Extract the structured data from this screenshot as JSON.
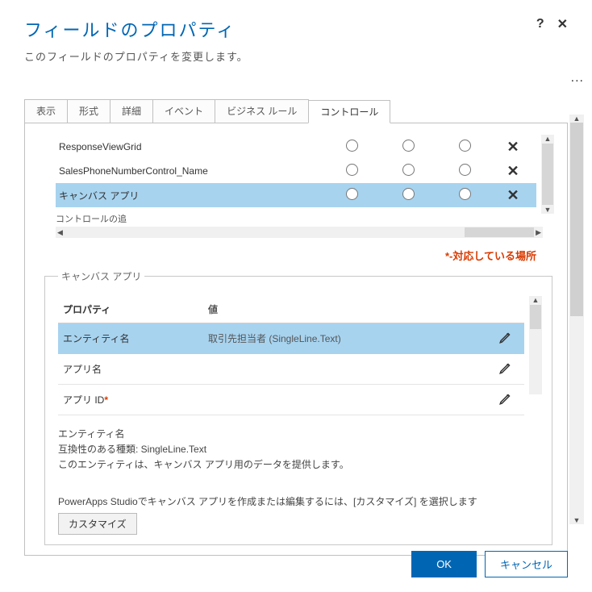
{
  "header": {
    "title": "フィールドのプロパティ",
    "subtitle": "このフィールドのプロパティを変更します。",
    "help_icon": "?",
    "close_icon": "✕",
    "overflow": "..."
  },
  "tabs": [
    {
      "label": "表示"
    },
    {
      "label": "形式"
    },
    {
      "label": "詳細"
    },
    {
      "label": "イベント"
    },
    {
      "label": "ビジネス ルール"
    },
    {
      "label": "コントロール",
      "active": true
    }
  ],
  "controls": {
    "rows": [
      {
        "name": "ResponseViewGrid",
        "close": "✕"
      },
      {
        "name": "SalesPhoneNumberControl_Name",
        "close": "✕"
      },
      {
        "name": "キャンバス アプリ",
        "selected": true,
        "close": "✕"
      }
    ],
    "scroll_caption": "コントロールの追"
  },
  "support_note": "*-対応している場所",
  "canvas": {
    "legend": "キャンバス アプリ",
    "header": {
      "prop": "プロパティ",
      "val": "値"
    },
    "rows": [
      {
        "prop": "エンティティ名",
        "val": "取引先担当者 (SingleLine.Text)",
        "selected": true,
        "required": false
      },
      {
        "prop": "アプリ名",
        "val": "",
        "required": false
      },
      {
        "prop": "アプリ ID",
        "val": "",
        "required": true
      }
    ],
    "description": {
      "line1": "エンティティ名",
      "line2": "互換性のある種類: SingleLine.Text",
      "line3": "このエンティティは、キャンバス アプリ用のデータを提供します。"
    },
    "studio_note": "PowerApps Studioでキャンバス アプリを作成または編集するには、[カスタマイズ] を選択します",
    "customize_label": "カスタマイズ"
  },
  "footer": {
    "ok": "OK",
    "cancel": "キャンセル"
  }
}
